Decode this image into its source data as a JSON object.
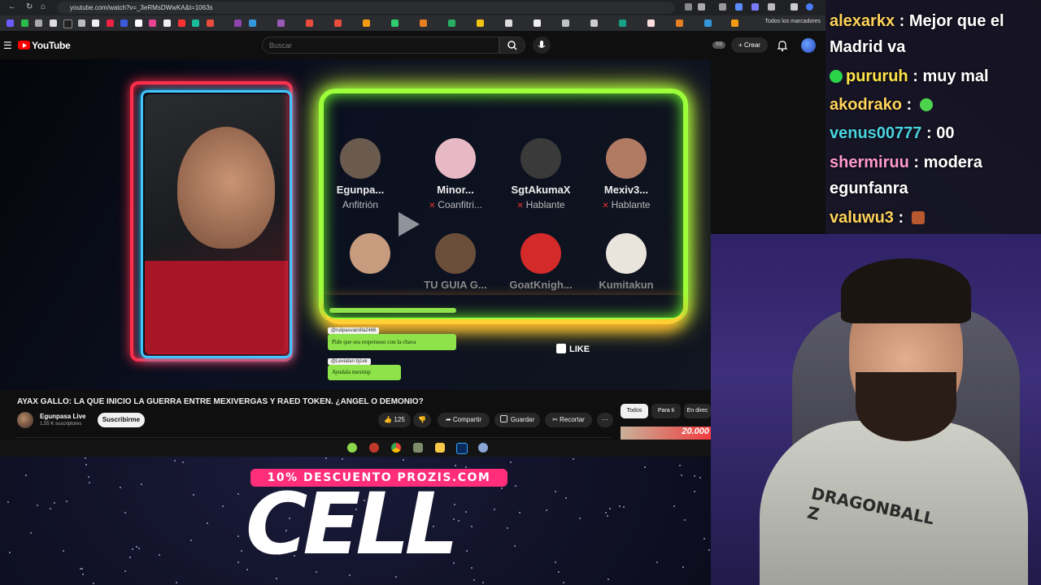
{
  "browser": {
    "url": "youtube.com/watch?v=_3eRMsDWwKA&t=1063s",
    "bookmarks_all_label": "Todos los marcadores"
  },
  "youtube": {
    "logo_text": "YouTube",
    "search_placeholder": "Buscar",
    "header_pill": "SS",
    "create_label": "Crear",
    "video_title": "AYAX GALLO: LA QUE INICIO LA GUERRA ENTRE MEXIVERGAS Y RAED TOKEN. ¿ANGEL O DEMONIO?",
    "channel_name": "Egunpasa Live",
    "channel_subs": "1,55 K suscriptores",
    "subscribe_label": "Suscribirme",
    "like_count": "125",
    "share_label": "Compartir",
    "save_label": "Guardar",
    "clip_label": "Recortar",
    "more_label": "···",
    "chips": [
      "Todos",
      "Para ti",
      "En direc"
    ],
    "thumbnail_text": "20.000"
  },
  "video": {
    "speakers": [
      {
        "name": "Egunpa...",
        "role": "Anfitrión",
        "color": "#6b5a4e",
        "muted": false
      },
      {
        "name": "Minor...",
        "role": "Coanfitri...",
        "color": "#e7b9c4",
        "muted": true
      },
      {
        "name": "SgtAkumaX",
        "role": "Hablante",
        "color": "#3a3a3a",
        "muted": true
      },
      {
        "name": "Mexiv3...",
        "role": "Hablante",
        "color": "#b07a63",
        "muted": true
      },
      {
        "name": "",
        "role": "",
        "color": "#c79b7e",
        "muted": false
      },
      {
        "name": "TU GUIA G...",
        "role": "",
        "color": "#6b4e3a",
        "muted": false
      },
      {
        "name": "GoatKnigh...",
        "role": "",
        "color": "#d42a2a",
        "muted": false
      },
      {
        "name": "Kumitakun",
        "role": "",
        "color": "#e9e4dc",
        "muted": false
      }
    ],
    "chat_handle_1": "@rulipasvainilla2486",
    "chat_msg_1": "Pide que sea respetuoso con la chava",
    "chat_handle_2": "@Leviatan bj1ek",
    "chat_msg_2": "Ayudala meximp",
    "like_label": "LIKE"
  },
  "stream_chat": [
    {
      "user": "alexarkx",
      "text": "Mejor que el Madrid va",
      "color": "#ffd35a",
      "badge": false,
      "emote": null
    },
    {
      "user": "pururuh",
      "text": "muy mal",
      "color": "#ffe54a",
      "badge": true,
      "emote": null
    },
    {
      "user": "akodrako",
      "text": "",
      "color": "#ffd35a",
      "badge": false,
      "emote": "#4cd34c"
    },
    {
      "user": "venus00777",
      "text": "00",
      "color": "#4ad3e0",
      "badge": false,
      "emote": null
    },
    {
      "user": "shermiruu",
      "text": "modera egunfanra",
      "color": "#ff9ad0",
      "badge": false,
      "emote": null
    },
    {
      "user": "valuwu3",
      "text": "",
      "color": "#ffd35a",
      "badge": false,
      "emote": "#b8582e"
    }
  ],
  "sponsor": {
    "promo_text": "10% DESCUENTO PROZIS.COM",
    "code": "CELL"
  },
  "streamer": {
    "hoodie_text": "DRAGONBALL Z"
  },
  "colors": {
    "youtube_red": "#ff0000",
    "neon_green": "#9dff3a",
    "neon_red": "#ff2d4a",
    "neon_blue": "#41c6ff",
    "promo_pink": "#ff2d7a"
  }
}
